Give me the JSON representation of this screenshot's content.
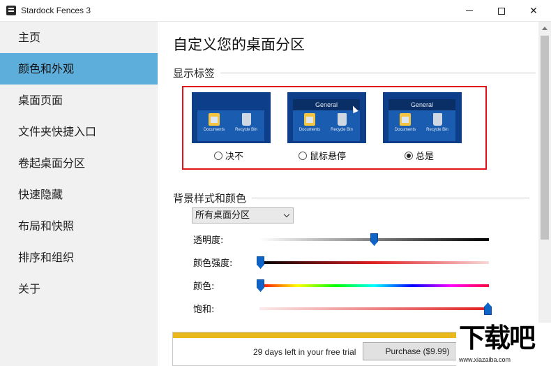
{
  "window": {
    "title": "Stardock Fences 3",
    "icons": {
      "app": "fences-app-icon",
      "minimize": "minimize-icon",
      "maximize": "maximize-icon",
      "close": "close-icon"
    }
  },
  "sidebar": {
    "items": [
      {
        "label": "主页",
        "active": false
      },
      {
        "label": "颜色和外观",
        "active": true
      },
      {
        "label": "桌面页面",
        "active": false
      },
      {
        "label": "文件夹快捷入口",
        "active": false
      },
      {
        "label": "卷起桌面分区",
        "active": false
      },
      {
        "label": "快速隐藏",
        "active": false
      },
      {
        "label": "布局和快照",
        "active": false
      },
      {
        "label": "排序和组织",
        "active": false
      },
      {
        "label": "关于",
        "active": false
      }
    ]
  },
  "main": {
    "title": "自定义您的桌面分区",
    "label_section": {
      "heading": "显示标签",
      "preview_header": "General",
      "tile_documents": "Documents",
      "tile_recycle": "Recycle Bin",
      "options": [
        {
          "label": "决不",
          "checked": false
        },
        {
          "label": "鼠标悬停",
          "checked": false
        },
        {
          "label": "总是",
          "checked": true
        }
      ]
    },
    "background_section": {
      "heading": "背景样式和颜色",
      "scope_select": {
        "value": "所有桌面分区"
      },
      "sliders": [
        {
          "label": "透明度:",
          "value": 0.5
        },
        {
          "label": "颜色强度:",
          "value": 0.0
        },
        {
          "label": "颜色:",
          "value": 0.0
        },
        {
          "label": "饱和:",
          "value": 1.0
        }
      ]
    },
    "trial": {
      "text": "29 days left in your free trial",
      "purchase_label": "Purchase ($9.99)"
    }
  },
  "watermark": {
    "title": "下载吧",
    "url": "www.xiazaiba.com"
  },
  "colors": {
    "accent": "#5eaedc",
    "highlight_border": "#e0121a",
    "slider_thumb": "#0f64c8",
    "trial_bar": "#e8b81c"
  }
}
